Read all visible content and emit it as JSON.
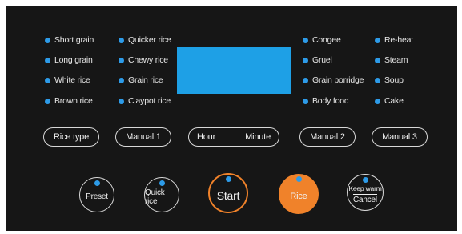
{
  "indicators": {
    "col1": [
      "Short grain",
      "Long grain",
      "White rice",
      "Brown rice"
    ],
    "col2": [
      "Quicker rice",
      "Chewy rice",
      "Grain rice",
      "Claypot rice"
    ],
    "col3": [
      "Congee",
      "Gruel",
      "Grain porridge",
      "Body food"
    ],
    "col4": [
      "Re-heat",
      "Steam",
      "Soup",
      "Cake"
    ]
  },
  "display": {
    "color": "#1ea0e6"
  },
  "function_buttons": {
    "rice_type": "Rice type",
    "manual_1": "Manual 1",
    "hour": "Hour",
    "minute": "Minute",
    "manual_2": "Manual 2",
    "manual_3": "Manual 3"
  },
  "round_buttons": {
    "preset": "Preset",
    "quick_rice": "Quick rice",
    "start": "Start",
    "rice": "Rice",
    "keep_warm": "Keep warm",
    "cancel": "Cancel"
  },
  "colors": {
    "panel": "#161616",
    "indicator": "#2d9be8",
    "accent": "#f0822a"
  }
}
